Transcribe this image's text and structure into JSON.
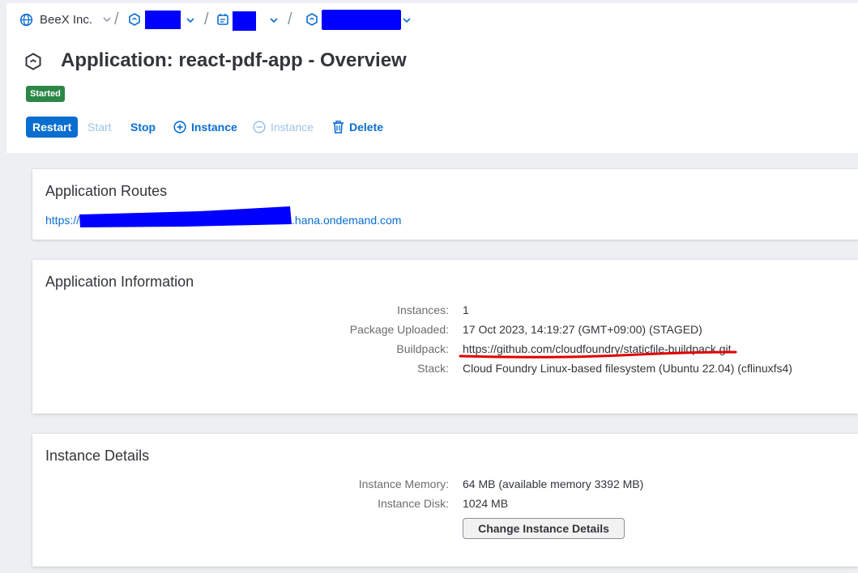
{
  "breadcrumb": {
    "org_label": "BeeX Inc.",
    "separator": "/"
  },
  "header": {
    "title": "Application: react-pdf-app - Overview",
    "status": "Started",
    "actions": {
      "restart": "Restart",
      "start": "Start",
      "stop": "Stop",
      "add_instance": "Instance",
      "remove_instance": "Instance",
      "delete": "Delete"
    }
  },
  "routes": {
    "title": "Application Routes",
    "url_prefix": "https://",
    "url_suffix": ".hana.ondemand.com"
  },
  "info": {
    "title": "Application Information",
    "rows": [
      {
        "label": "Instances:",
        "value": "1"
      },
      {
        "label": "Package Uploaded:",
        "value": "17 Oct 2023, 14:19:27 (GMT+09:00) (STAGED)"
      },
      {
        "label": "Buildpack:",
        "value": "https://github.com/cloudfoundry/staticfile-buildpack.git"
      },
      {
        "label": "Stack:",
        "value": "Cloud Foundry Linux-based filesystem (Ubuntu 22.04) (cflinuxfs4)"
      }
    ]
  },
  "instance": {
    "title": "Instance Details",
    "rows": [
      {
        "label": "Instance Memory:",
        "value": "64 MB (available memory 3392 MB)"
      },
      {
        "label": "Instance Disk:",
        "value": "1024 MB"
      }
    ],
    "change_button": "Change Instance Details"
  },
  "colors": {
    "accent": "#0a6ed1",
    "status_started": "#2b8745",
    "redaction": "#0000ff",
    "annotation_underline": "#e00000"
  }
}
